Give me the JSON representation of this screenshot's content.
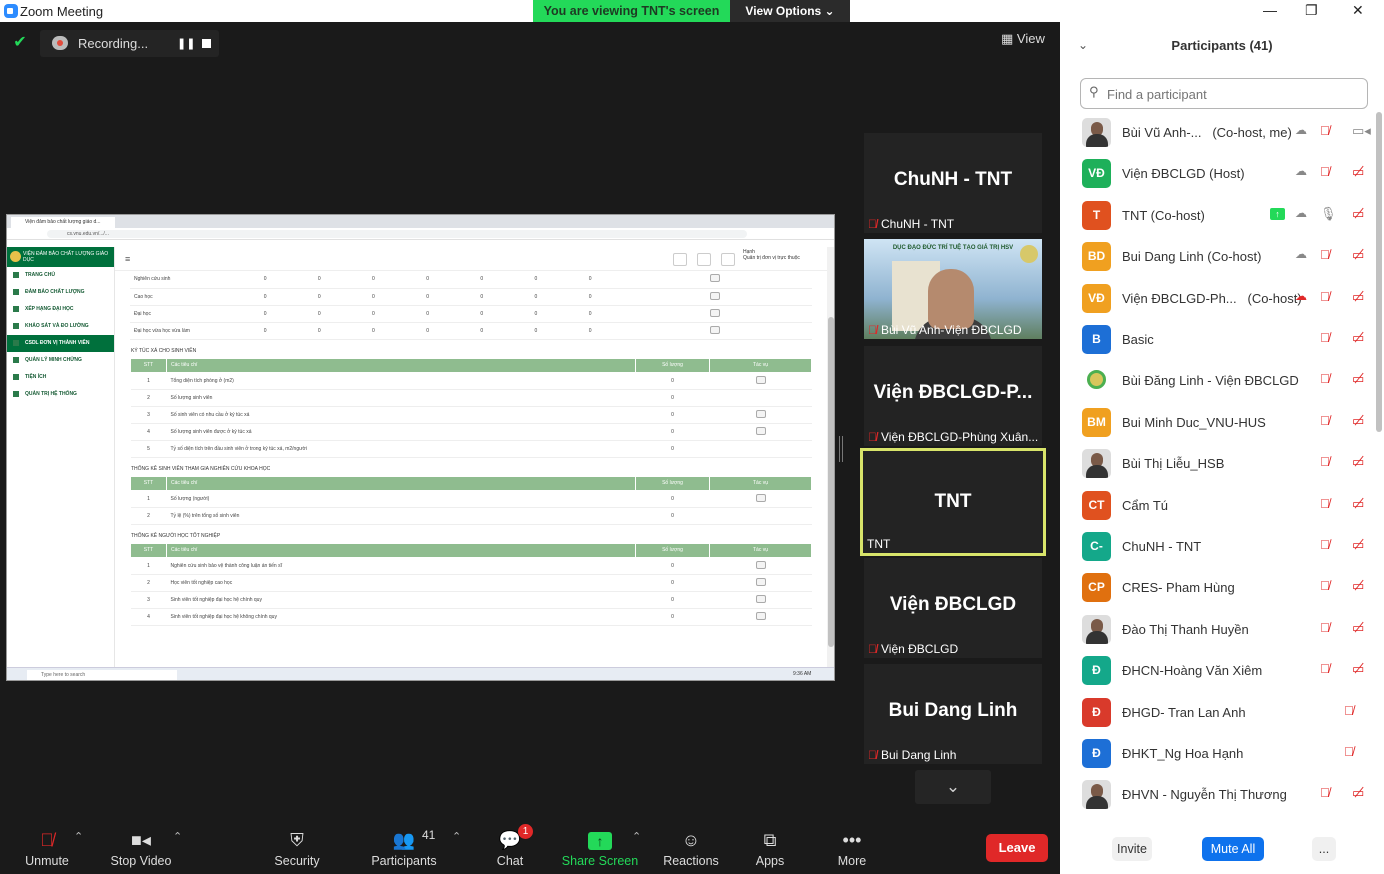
{
  "window": {
    "title": "Zoom Meeting",
    "viewing_banner": "You are viewing TNT's screen",
    "view_options": "View Options ⌄",
    "minimize": "—",
    "maximize": "❐",
    "close": "✕"
  },
  "recording": {
    "label": "Recording...",
    "pause": "❚❚"
  },
  "view_button": "View",
  "shared_screen": {
    "tab": "Viện đảm bảo chất lượng giáo d...",
    "url": "cs.vnu.edu.vn/.../...",
    "brand": "VIỆN ĐẢM BẢO CHẤT LƯỢNG GIÁO DỤC",
    "menu": [
      "TRANG CHỦ",
      "ĐẢM BẢO CHẤT LƯỢNG",
      "XẾP HẠNG ĐẠI HỌC",
      "KHẢO SÁT VÀ ĐO LƯỜNG",
      "CSDL ĐƠN VỊ THÀNH VIÊN",
      "QUẢN LÝ MINH CHỨNG",
      "TIỆN ÍCH",
      "QUẢN TRỊ HỆ THỐNG"
    ],
    "user": "Hạnh",
    "user_role": "Quản trị đơn vị trực thuộc",
    "top_rows": [
      {
        "name": "Nghiên cứu sinh",
        "v": [
          "0",
          "0",
          "0",
          "0",
          "0",
          "0",
          "0"
        ]
      },
      {
        "name": "Cao học",
        "v": [
          "0",
          "0",
          "0",
          "0",
          "0",
          "0",
          "0"
        ]
      },
      {
        "name": "Đại học",
        "v": [
          "0",
          "0",
          "0",
          "0",
          "0",
          "0",
          "0"
        ]
      },
      {
        "name": "Đại học vừa học vừa làm",
        "v": [
          "0",
          "0",
          "0",
          "0",
          "0",
          "0",
          "0"
        ]
      }
    ],
    "headers": {
      "stt": "STT",
      "criteria": "Các tiêu chí",
      "qty": "Số lượng",
      "action": "Tác vụ"
    },
    "sections": [
      {
        "title": "KÝ TÚC XÁ CHO SINH VIÊN",
        "rows": [
          {
            "stt": "1",
            "name": "Tổng diện tích phòng ở (m2)",
            "qty": "0"
          },
          {
            "stt": "2",
            "name": "Số lượng sinh viên",
            "qty": "0"
          },
          {
            "stt": "3",
            "name": "Số sinh viên có nhu cầu ở ký túc xá",
            "qty": "0"
          },
          {
            "stt": "4",
            "name": "Số lượng sinh viên được ở ký túc xá",
            "qty": "0"
          },
          {
            "stt": "5",
            "name": "Tỷ số diện tích trên đầu sinh viên ở trong ký túc xá, m2/người",
            "qty": "0"
          }
        ]
      },
      {
        "title": "THỐNG KÊ SINH VIÊN THAM GIA NGHIÊN CỨU KHOA HỌC",
        "rows": [
          {
            "stt": "1",
            "name": "Số lượng (người)",
            "qty": "0"
          },
          {
            "stt": "2",
            "name": "Tỷ lệ (%) trên tổng số sinh viên",
            "qty": "0"
          }
        ]
      },
      {
        "title": "THỐNG KÊ NGƯỜI HỌC TỐT NGHIỆP",
        "rows": [
          {
            "stt": "1",
            "name": "Nghiên cứu sinh bảo vệ thành công luận án tiến sĩ",
            "qty": "0"
          },
          {
            "stt": "2",
            "name": "Học viên tốt nghiệp cao học",
            "qty": "0"
          },
          {
            "stt": "3",
            "name": "Sinh viên tốt nghiệp đại học hệ chính quy",
            "qty": "0"
          },
          {
            "stt": "4",
            "name": "Sinh viên tốt nghiệp đại học hệ không chính quy",
            "qty": "0"
          }
        ]
      }
    ],
    "taskbar_search": "Type here to search",
    "clock": "9:36 AM"
  },
  "tiles": [
    {
      "big": "ChuNH - TNT",
      "name": "ChuNH - TNT"
    },
    {
      "big": "",
      "name": "Bùi Vũ Anh-Viện ĐBCLGD",
      "banner": "DỤC ĐẠO ĐỨC TRÍ TUỆ TẠO GIÁ TRỊ HSV"
    },
    {
      "big": "Viện ĐBCLGD-P...",
      "name": "Viện ĐBCLGD-Phùng Xuân..."
    },
    {
      "big": "TNT",
      "name": "TNT"
    },
    {
      "big": "Viện ĐBCLGD",
      "name": "Viện ĐBCLGD"
    },
    {
      "big": "Bui Dang Linh",
      "name": "Bui Dang Linh"
    }
  ],
  "toolbar": {
    "unmute": "Unmute",
    "stop_video": "Stop Video",
    "security": "Security",
    "participants": "Participants",
    "participants_count": "41",
    "chat": "Chat",
    "chat_badge": "1",
    "share_screen": "Share Screen",
    "reactions": "Reactions",
    "apps": "Apps",
    "more": "More",
    "leave": "Leave"
  },
  "panel": {
    "title": "Participants (41)",
    "search_placeholder": "Find a participant",
    "participants": [
      {
        "initials": "",
        "name": "Bùi Vũ Anh-...",
        "role": "(Co-host, me)",
        "color": "photo"
      },
      {
        "initials": "VĐ",
        "name": "Viện ĐBCLGD (Host)",
        "role": "",
        "color": "#1eb05a"
      },
      {
        "initials": "T",
        "name": "TNT (Co-host)",
        "role": "",
        "color": "#e0511f"
      },
      {
        "initials": "BD",
        "name": "Bui Dang Linh (Co-host)",
        "role": "",
        "color": "#f0a020"
      },
      {
        "initials": "VĐ",
        "name": "Viện ĐBCLGD-Ph...",
        "role": "(Co-host)",
        "color": "#f0a020"
      },
      {
        "initials": "B",
        "name": "Basic",
        "role": "",
        "color": "#1d6fd6"
      },
      {
        "initials": "",
        "name": "Bùi Đăng Linh - Viện ĐBCLGD",
        "role": "",
        "color": "logo"
      },
      {
        "initials": "BM",
        "name": "Bui Minh Duc_VNU-HUS",
        "role": "",
        "color": "#f0a020"
      },
      {
        "initials": "",
        "name": "Bùi Thị Liễu_HSB",
        "role": "",
        "color": "photo"
      },
      {
        "initials": "CT",
        "name": "Cẩm Tú",
        "role": "",
        "color": "#e0511f"
      },
      {
        "initials": "C-",
        "name": "ChuNH - TNT",
        "role": "",
        "color": "#14a88a"
      },
      {
        "initials": "CP",
        "name": "CRES- Pham Hùng",
        "role": "",
        "color": "#e0700f"
      },
      {
        "initials": "",
        "name": "Đào Thị Thanh Huyền",
        "role": "",
        "color": "photo"
      },
      {
        "initials": "Đ",
        "name": "ĐHCN-Hoàng Văn Xiêm",
        "role": "",
        "color": "#14a88a"
      },
      {
        "initials": "Đ",
        "name": "ĐHGD- Tran Lan Anh",
        "role": "",
        "color": "#d93a2b"
      },
      {
        "initials": "Đ",
        "name": "ĐHKT_Ng Hoa Hạnh",
        "role": "",
        "color": "#1d6fd6"
      },
      {
        "initials": "",
        "name": "ĐHVN - Nguyễn Thị Thương",
        "role": "",
        "color": "photo"
      }
    ],
    "invite": "Invite",
    "mute_all": "Mute All",
    "more": "..."
  }
}
